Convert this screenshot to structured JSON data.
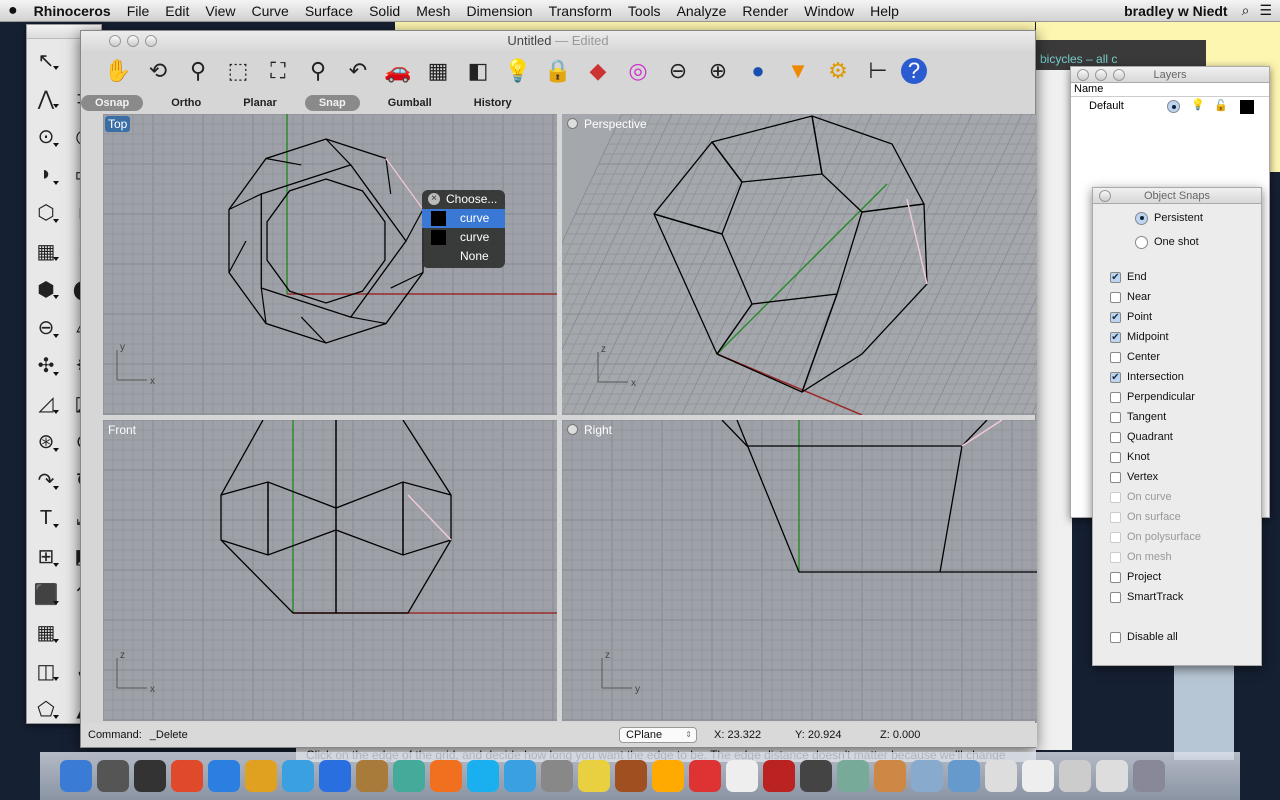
{
  "menubar": {
    "apple": "",
    "app": "Rhinoceros",
    "items": [
      "File",
      "Edit",
      "View",
      "Curve",
      "Surface",
      "Solid",
      "Mesh",
      "Dimension",
      "Transform",
      "Tools",
      "Analyze",
      "Render",
      "Window",
      "Help"
    ],
    "user": "bradley w Niedt"
  },
  "window": {
    "title": "Untitled",
    "edited": "— Edited"
  },
  "toolbar": [
    "hand-pan-icon",
    "rotate-view-icon",
    "zoom-icon",
    "zoom-window-icon",
    "zoom-extents-icon",
    "zoom-selected-icon",
    "undo-view-icon",
    "car-render-icon",
    "grid-icon",
    "layer-shapes-icon",
    "lightbulb-icon",
    "lock-icon",
    "material-icon",
    "color-wheel-icon",
    "sphere-wire-icon",
    "sphere-grid-icon",
    "blue-sphere-icon",
    "spotlight-icon",
    "gear-icon",
    "dimension-icon",
    "help-icon"
  ],
  "tabs": [
    {
      "label": "Osnap",
      "on": true
    },
    {
      "label": "Ortho",
      "on": false
    },
    {
      "label": "Planar",
      "on": false
    },
    {
      "label": "Snap",
      "on": true
    },
    {
      "label": "Gumball",
      "on": false
    },
    {
      "label": "History",
      "on": false
    }
  ],
  "viewports": {
    "top": "Top",
    "perspective": "Perspective",
    "front": "Front",
    "right": "Right"
  },
  "axes": {
    "x": "x",
    "y": "y",
    "z": "z"
  },
  "popup": {
    "title": "Choose...",
    "items": [
      "curve",
      "curve",
      "None"
    ]
  },
  "command": {
    "label": "Command:",
    "value": "_Delete",
    "cplane": "CPlane",
    "x": "X: 23.322",
    "y": "Y: 20.924",
    "z": "Z: 0.000"
  },
  "behind_text": "Click on the edge of the grid, and decide how long you want the edge to be. The edge distance doesn't matter because we'll change",
  "browser_tab": "bicycles – all c",
  "layers": {
    "title": "Layers",
    "col_name": "Name",
    "rows": [
      {
        "name": "Default",
        "color": "#000000"
      }
    ]
  },
  "osnaps": {
    "title": "Object Snaps",
    "modes": [
      {
        "label": "Persistent",
        "on": true
      },
      {
        "label": "One shot",
        "on": false
      }
    ],
    "items": [
      {
        "label": "End",
        "checked": true
      },
      {
        "label": "Near",
        "checked": false
      },
      {
        "label": "Point",
        "checked": true
      },
      {
        "label": "Midpoint",
        "checked": true
      },
      {
        "label": "Center",
        "checked": false
      },
      {
        "label": "Intersection",
        "checked": true
      },
      {
        "label": "Perpendicular",
        "checked": false
      },
      {
        "label": "Tangent",
        "checked": false
      },
      {
        "label": "Quadrant",
        "checked": false
      },
      {
        "label": "Knot",
        "checked": false
      },
      {
        "label": "Vertex",
        "checked": false
      },
      {
        "label": "On curve",
        "checked": false,
        "disabled": true
      },
      {
        "label": "On surface",
        "checked": false,
        "disabled": true
      },
      {
        "label": "On polysurface",
        "checked": false,
        "disabled": true
      },
      {
        "label": "On mesh",
        "checked": false,
        "disabled": true
      },
      {
        "label": "Project",
        "checked": false
      },
      {
        "label": "SmartTrack",
        "checked": false
      }
    ],
    "disable_all": "Disable all"
  },
  "palette": [
    "↖",
    "∘",
    "⋀",
    "⊃",
    "⊙",
    "◎",
    "◗",
    "▭",
    "⬡",
    "↱",
    "▦",
    "◔",
    "⬢",
    "⬤",
    "⊖",
    "▱",
    "✣",
    "✸",
    "◿",
    "◪",
    "⊛",
    "⊙",
    "↷",
    "↻",
    "T",
    "⤢",
    "⊞",
    "◩",
    "⬛",
    "⇈",
    "▦",
    "⋮",
    "◫",
    "✓",
    "⬠",
    "◭"
  ],
  "dock": [
    "#3a7bd5",
    "#555",
    "#333",
    "#e04a2a",
    "#2a7fe0",
    "#e0a020",
    "#3aa0e0",
    "#2a6fe0",
    "#a87b3a",
    "#4a9",
    "#f07020",
    "#1ab0f0",
    "#3aa0e0",
    "#888",
    "#e8d040",
    "#a05020",
    "#fa0",
    "#d33",
    "#eee",
    "#b22",
    "#444",
    "#7a9",
    "#c84",
    "#8ac",
    "#69c",
    "#ddd",
    "#eee",
    "#ccc",
    "#ddd",
    "#889"
  ]
}
